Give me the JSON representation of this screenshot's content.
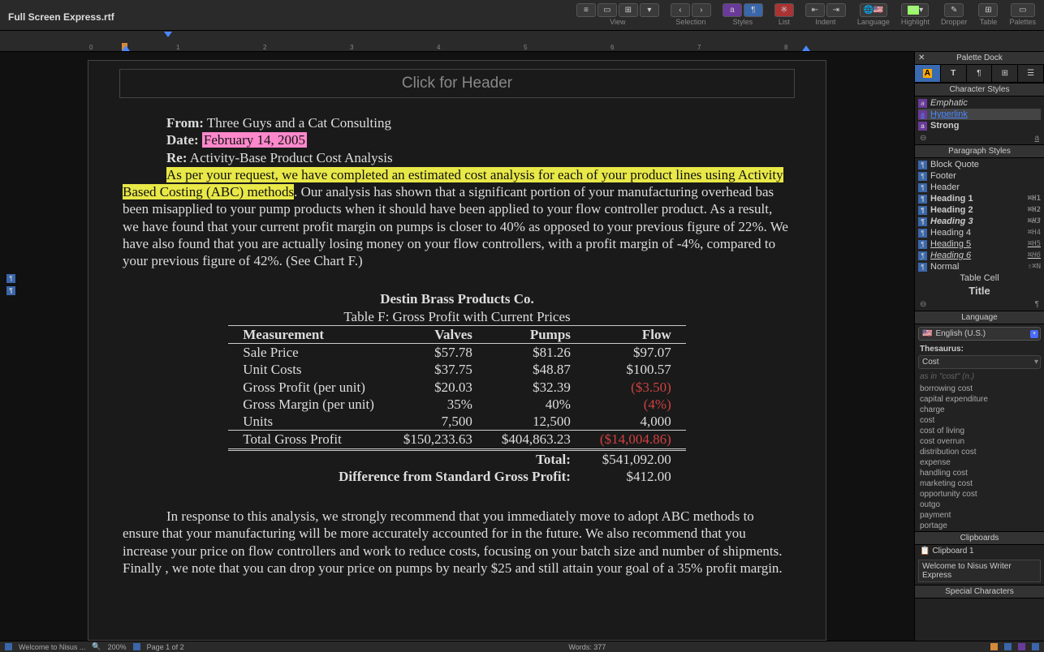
{
  "window": {
    "title": "Full Screen Express.rtf"
  },
  "toolbar": {
    "view": {
      "label": "View"
    },
    "selection": {
      "label": "Selection"
    },
    "styles": {
      "label": "Styles"
    },
    "list": {
      "label": "List"
    },
    "indent": {
      "label": "Indent"
    },
    "language": {
      "label": "Language"
    },
    "highlight": {
      "label": "Highlight"
    },
    "dropper": {
      "label": "Dropper"
    },
    "table": {
      "label": "Table"
    },
    "palettes": {
      "label": "Palettes"
    }
  },
  "document": {
    "header_placeholder": "Click for Header",
    "from_label": "From:",
    "from_value": "Three Guys and a Cat Consulting",
    "date_label": "Date:",
    "date_value": "February 14, 2005",
    "re_label": "Re:",
    "re_value": "Activity-Base Product Cost Analysis",
    "para1_hl": "As per your request, we have completed an estimated cost analysis for each of your product lines using Activity Based Costing (ABC) methods",
    "para1_rest": ". Our analysis has shown that a significant portion of your manufacturing overhead bas been misapplied to your pump products when it should have been applied to your flow controller product. As a result, we have found that your current profit margin on pumps is closer to 40% as opposed to your previous figure of 22%. We have also found that you are actually losing money on your flow controllers, with a profit margin of -4%, compared to your previous figure of 42%. (See Chart F.)",
    "table_company": "Destin Brass Products Co.",
    "table_title": "Table F: Gross Profit with Current Prices",
    "cols": {
      "c0": "Measurement",
      "c1": "Valves",
      "c2": "Pumps",
      "c3": "Flow"
    },
    "rows": {
      "r0": {
        "label": "Sale Price",
        "v": "$57.78",
        "p": "$81.26",
        "f": "$97.07"
      },
      "r1": {
        "label": "Unit Costs",
        "v": "$37.75",
        "p": "$48.87",
        "f": "$100.57"
      },
      "r2": {
        "label": "Gross Profit (per unit)",
        "v": "$20.03",
        "p": "$32.39",
        "f": "($3.50)"
      },
      "r3": {
        "label": "Gross Margin (per unit)",
        "v": "35%",
        "p": "40%",
        "f": "(4%)"
      },
      "r4": {
        "label": "Units",
        "v": "7,500",
        "p": "12,500",
        "f": "4,000"
      },
      "r5": {
        "label": "Total Gross Profit",
        "v": "$150,233.63",
        "p": "$404,863.23",
        "f": "($14,004.86)"
      }
    },
    "total_label": "Total:",
    "total_value": "$541,092.00",
    "diff_label": "Difference from Standard Gross Profit:",
    "diff_value": "$412.00",
    "para2": "In response to this analysis, we strongly recommend that you immediately move to adopt ABC methods to ensure that your manufacturing will be more accurately accounted for in the future. We also recommend that you increase your price on flow controllers and work to reduce costs, focusing on your batch size and number of shipments. Finally , we note that you can drop your price on pumps by nearly $25 and still attain your goal of a 35% profit margin."
  },
  "palette": {
    "dock_title": "Palette Dock",
    "char_styles_head": "Character Styles",
    "char_styles": {
      "emphatic": "Emphatic",
      "hyperlink": "Hyperlink",
      "strong": "Strong"
    },
    "para_styles_head": "Paragraph Styles",
    "para_styles": {
      "block_quote": {
        "name": "Block Quote",
        "hot": ""
      },
      "footer": {
        "name": "Footer",
        "hot": ""
      },
      "header": {
        "name": "Header",
        "hot": ""
      },
      "h1": {
        "name": "Heading 1",
        "hot": "⌘H1"
      },
      "h2": {
        "name": "Heading 2",
        "hot": "⌘H2"
      },
      "h3": {
        "name": "Heading 3",
        "hot": "⌘H3"
      },
      "h4": {
        "name": "Heading 4",
        "hot": "⌘H4"
      },
      "h5": {
        "name": "Heading 5",
        "hot": "⌘H5"
      },
      "h6": {
        "name": "Heading 6",
        "hot": "⌘H6"
      },
      "normal": {
        "name": "Normal",
        "hot": "⇧⌘N"
      },
      "table_cell": {
        "name": "Table Cell",
        "hot": ""
      },
      "title": {
        "name": "Title",
        "hot": ""
      }
    },
    "language_head": "Language",
    "language_value": "English (U.S.)",
    "thesaurus_label": "Thesaurus:",
    "thesaurus_word": "Cost",
    "thesaurus_hint": "as in \"cost\" (n.)",
    "thesaurus_list": [
      "borrowing cost",
      "capital expenditure",
      "charge",
      "cost",
      "cost of living",
      "cost overrun",
      "distribution cost",
      "expense",
      "handling cost",
      "marketing cost",
      "opportunity cost",
      "outgo",
      "payment",
      "portage"
    ],
    "clipboards_head": "Clipboards",
    "clipboard_name": "Clipboard 1",
    "clipboard_content": "Welcome to Nisus Writer Express",
    "special_head": "Special Characters"
  },
  "statusbar": {
    "doc_switch": "Welcome to Nisus ...",
    "zoom": "200%",
    "page": "Page 1 of 2",
    "words": "Words: 377"
  },
  "chart_data": {
    "type": "table",
    "title": "Table F: Gross Profit with Current Prices",
    "company": "Destin Brass Products Co.",
    "columns": [
      "Measurement",
      "Valves",
      "Pumps",
      "Flow"
    ],
    "rows": [
      [
        "Sale Price",
        57.78,
        81.26,
        97.07
      ],
      [
        "Unit Costs",
        37.75,
        48.87,
        100.57
      ],
      [
        "Gross Profit (per unit)",
        20.03,
        32.39,
        -3.5
      ],
      [
        "Gross Margin (per unit)",
        0.35,
        0.4,
        -0.04
      ],
      [
        "Units",
        7500,
        12500,
        4000
      ],
      [
        "Total Gross Profit",
        150233.63,
        404863.23,
        -14004.86
      ]
    ],
    "totals": {
      "Total": 541092.0,
      "Difference from Standard Gross Profit": 412.0
    }
  }
}
